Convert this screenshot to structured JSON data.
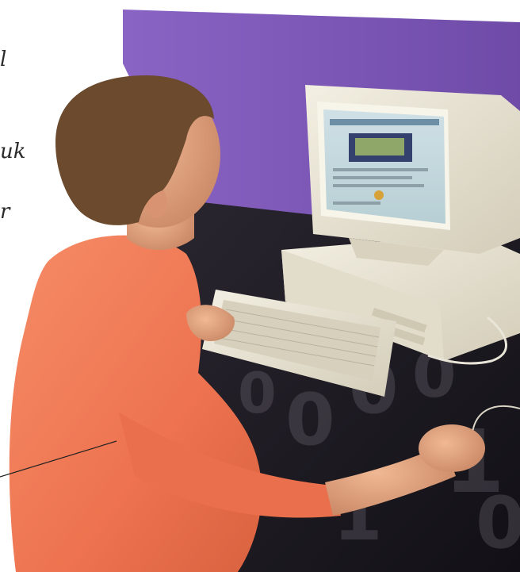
{
  "margin_text": {
    "line_top": "l",
    "line_mid": "uk",
    "line_low": "r"
  },
  "monitor_screen": {
    "content": "web page with banner image"
  },
  "overlay_digits": "010011010 0011",
  "colors": {
    "shirt": "#f07a55",
    "partition": "#7a55b0",
    "beige_hardware": "#e7e2d2",
    "desk": "#1e1b22",
    "skin": "#e2a886",
    "hair": "#6b4a2e"
  }
}
